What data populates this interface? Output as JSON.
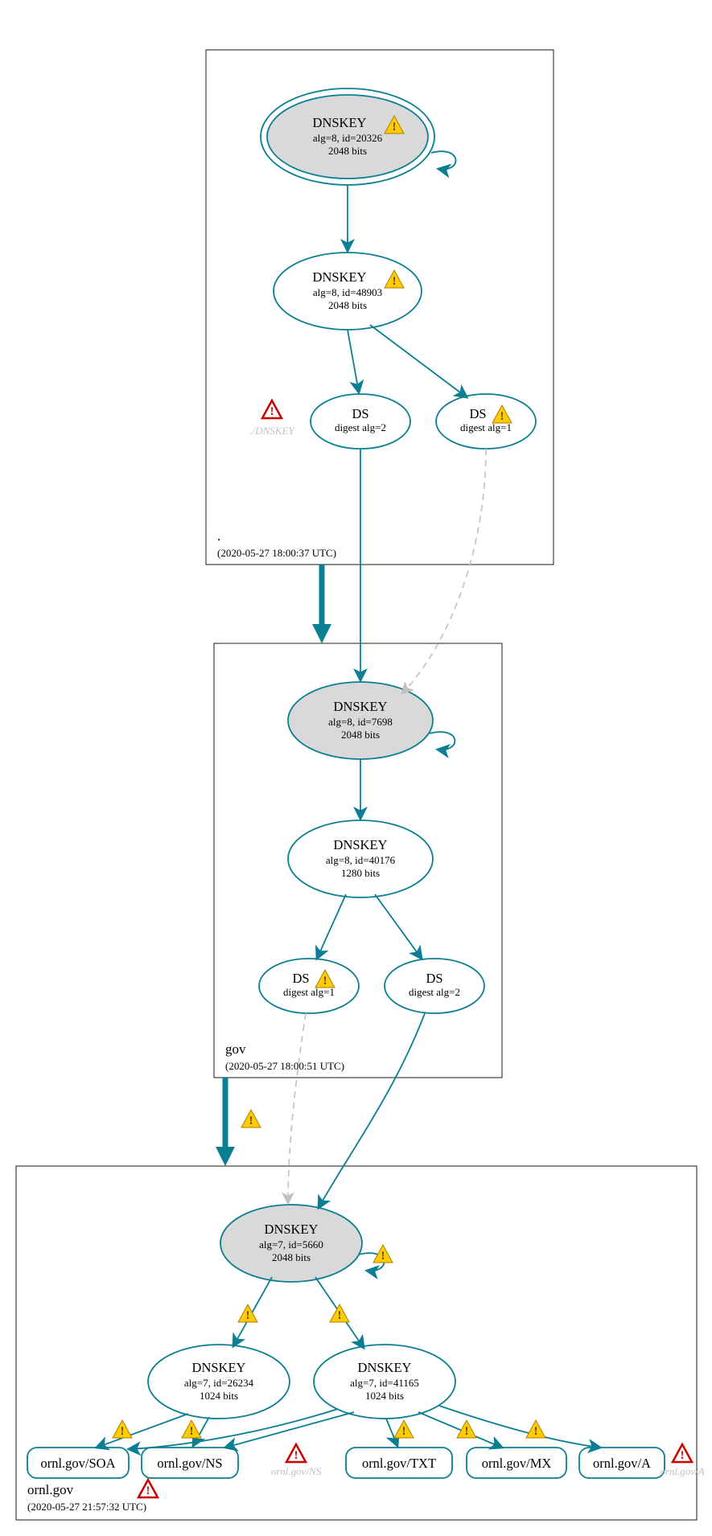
{
  "zones": {
    "root": {
      "name": ".",
      "timestamp": "(2020-05-27 18:00:37 UTC)"
    },
    "gov": {
      "name": "gov",
      "timestamp": "(2020-05-27 18:00:51 UTC)"
    },
    "ornl": {
      "name": "ornl.gov",
      "timestamp": "(2020-05-27 21:57:32 UTC)"
    }
  },
  "nodes": {
    "root_ksk": {
      "title": "DNSKEY",
      "l1": "alg=8, id=20326",
      "l2": "2048 bits"
    },
    "root_zsk": {
      "title": "DNSKEY",
      "l1": "alg=8, id=48903",
      "l2": "2048 bits"
    },
    "root_ds2": {
      "title": "DS",
      "l1": "digest alg=2"
    },
    "root_ds1": {
      "title": "DS",
      "l1": "digest alg=1"
    },
    "gov_ksk": {
      "title": "DNSKEY",
      "l1": "alg=8, id=7698",
      "l2": "2048 bits"
    },
    "gov_zsk": {
      "title": "DNSKEY",
      "l1": "alg=8, id=40176",
      "l2": "1280 bits"
    },
    "gov_ds1": {
      "title": "DS",
      "l1": "digest alg=1"
    },
    "gov_ds2": {
      "title": "DS",
      "l1": "digest alg=2"
    },
    "ornl_ksk": {
      "title": "DNSKEY",
      "l1": "alg=7, id=5660",
      "l2": "2048 bits"
    },
    "ornl_zsk1": {
      "title": "DNSKEY",
      "l1": "alg=7, id=26234",
      "l2": "1024 bits"
    },
    "ornl_zsk2": {
      "title": "DNSKEY",
      "l1": "alg=7, id=41165",
      "l2": "1024 bits"
    }
  },
  "ghosts": {
    "root_dnskey": "./DNSKEY",
    "ornl_ns": "ornl.gov/NS",
    "ornl_a": "ornl.gov/A"
  },
  "rr": {
    "soa": "ornl.gov/SOA",
    "ns": "ornl.gov/NS",
    "txt": "ornl.gov/TXT",
    "mx": "ornl.gov/MX",
    "a": "ornl.gov/A"
  }
}
